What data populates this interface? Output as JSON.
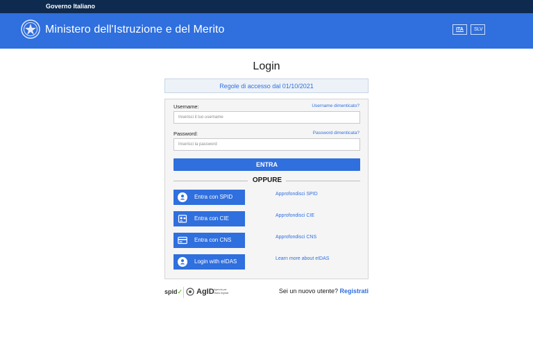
{
  "gov_bar": {
    "label": "Governo Italiano"
  },
  "header": {
    "title": "Ministero dell'Istruzione e del Merito",
    "languages": [
      "ITA",
      "SLV"
    ],
    "selected_language": "ITA"
  },
  "login": {
    "title": "Login",
    "rules_link": "Regole di accesso dal 01/10/2021",
    "username_label": "Username:",
    "username_forgot": "Username dimenticato?",
    "username_placeholder": "Inserisci il tuo username",
    "password_label": "Password:",
    "password_forgot": "Password dimenticata?",
    "password_placeholder": "Inserisci la password",
    "submit_label": "ENTRA",
    "separator": "OPPURE"
  },
  "auth_options": [
    {
      "label": "Entra con SPID",
      "icon": "user-circle-icon",
      "info": "Approfondisci SPID"
    },
    {
      "label": "Entra con CIE",
      "icon": "id-card-chip-icon",
      "info": "Approfondisci CIE"
    },
    {
      "label": "Entra con CNS",
      "icon": "smart-card-icon",
      "info": "Approfondisci CNS"
    },
    {
      "label": "Login with eIDAS",
      "icon": "user-circle-icon",
      "info": "Learn more about eIDAS"
    }
  ],
  "footer": {
    "spid_logo": "spid",
    "agid_logo": "AgID",
    "agid_subtitle": "Agenzia per l'Italia Digitale",
    "new_user_text": "Sei un nuovo utente?",
    "register_link": "Registrati"
  },
  "colors": {
    "gov_bar": "#0e2a4f",
    "header": "#2f6fde",
    "accent": "#2f6fde"
  }
}
